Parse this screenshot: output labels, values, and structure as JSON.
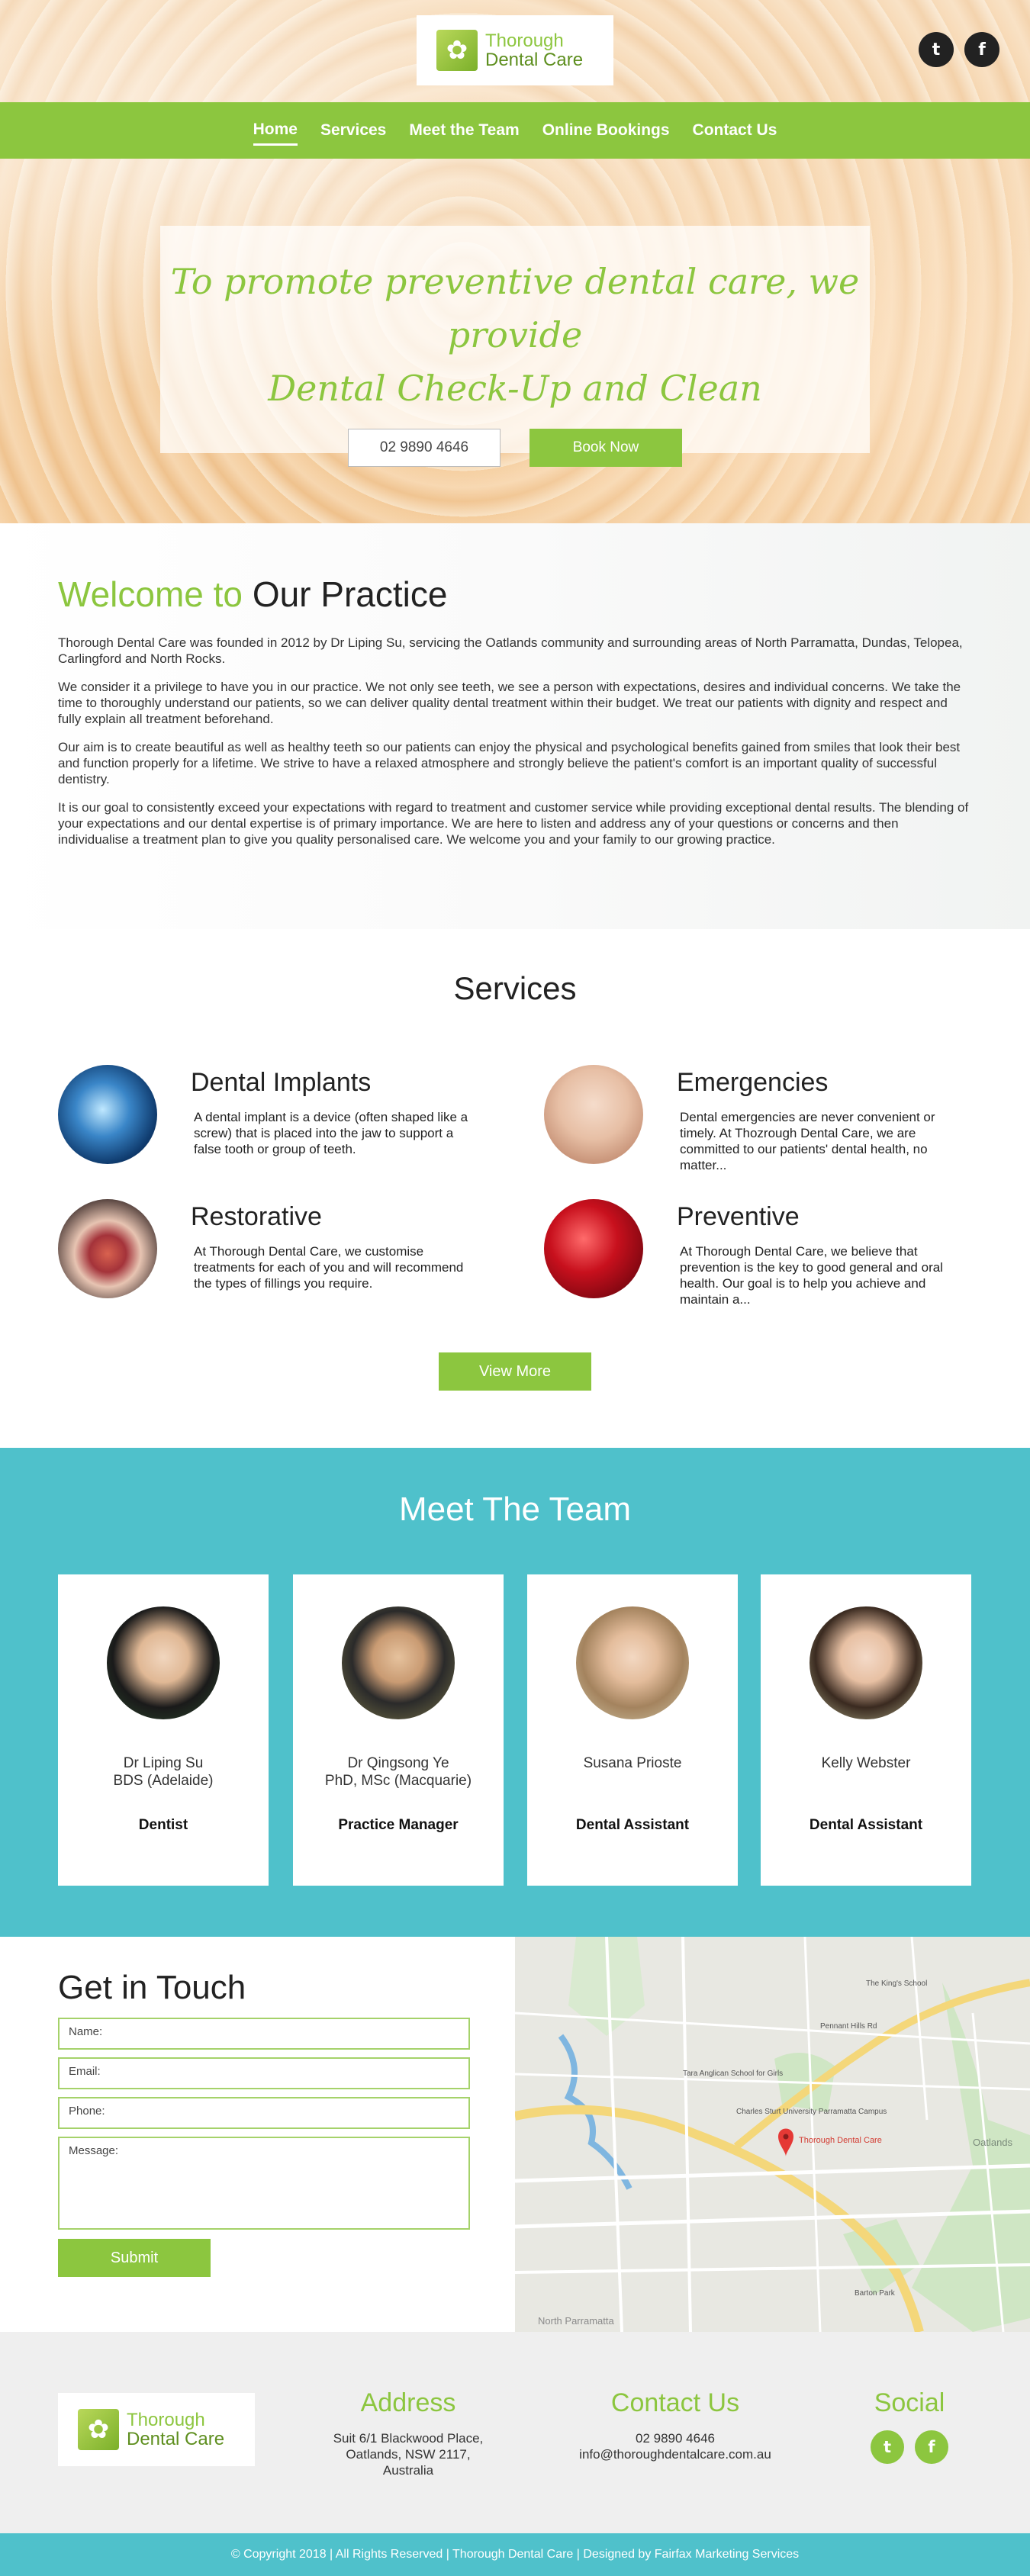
{
  "brand": {
    "name_line1": "Thorough",
    "name_line2": "Dental Care"
  },
  "nav": [
    {
      "label": "Home"
    },
    {
      "label": "Services"
    },
    {
      "label": "Meet the Team"
    },
    {
      "label": "Online Bookings"
    },
    {
      "label": "Contact Us"
    }
  ],
  "hero": {
    "line1": "To promote preventive dental care, we provide",
    "line2": "Dental Check-Up and Clean",
    "phone": "02 9890 4646",
    "book": "Book Now"
  },
  "welcome": {
    "title_green": "Welcome to",
    "title_dark": "Our Practice",
    "paragraphs": [
      "Thorough Dental Care was founded in 2012 by Dr Liping Su, servicing the Oatlands community and surrounding areas of North Parramatta, Dundas, Telopea, Carlingford and North Rocks.",
      "We consider it a privilege to have you in our practice. We not only see teeth, we see a person with expectations, desires and individual concerns. We take the time to thoroughly understand our patients, so we can deliver quality dental treatment within their budget. We treat our patients with dignity and respect and fully explain all treatment beforehand.",
      "Our aim is to create beautiful as well as healthy teeth so our patients can enjoy the physical and psychological benefits gained from smiles that look their best and function properly for a lifetime. We strive to have a relaxed atmosphere and strongly believe the patient's comfort is an important quality of successful dentistry.",
      "It is our goal to consistently exceed your expectations with regard to treatment and customer service while providing exceptional dental results. The blending of your expectations and our dental expertise is of primary importance. We are here to listen and address any of your questions or concerns and then individualise a treatment plan to give you quality personalised care. We welcome you and your family to our growing practice."
    ]
  },
  "services": {
    "title": "Services",
    "items": [
      {
        "title": "Dental Implants",
        "desc": "A dental implant is a device (often shaped like a screw) that is placed into the jaw to support a false tooth or group of teeth."
      },
      {
        "title": "Emergencies",
        "desc": "Dental emergencies are never convenient or timely. At Thozrough Dental Care, we are committed to our patients' dental health, no matter..."
      },
      {
        "title": "Restorative",
        "desc": "At Thorough Dental Care, we customise treatments for each of you and will recommend the types of fillings you require."
      },
      {
        "title": "Preventive",
        "desc": "At Thorough Dental Care, we believe that prevention is the key to good general and oral health. Our goal is to help you achieve and maintain a..."
      }
    ],
    "more": "View More"
  },
  "team": {
    "title": "Meet The Team",
    "members": [
      {
        "name": "Dr Liping Su",
        "cred": "BDS (Adelaide)",
        "role": "Dentist"
      },
      {
        "name": "Dr Qingsong Ye",
        "cred": "PhD, MSc (Macquarie)",
        "role": "Practice Manager"
      },
      {
        "name": "Susana Prioste",
        "cred": "",
        "role": "Dental Assistant"
      },
      {
        "name": "Kelly Webster",
        "cred": "",
        "role": "Dental Assistant"
      }
    ]
  },
  "contact": {
    "title": "Get in Touch",
    "name_ph": "Name:",
    "email_ph": "Email:",
    "phone_ph": "Phone:",
    "message_ph": "Message:",
    "submit": "Submit"
  },
  "map": {
    "pin_label": "Thorough Dental Care",
    "labels": [
      "The King's School",
      "Tara Anglican School for Girls",
      "Charles Sturt University Parramatta Campus",
      "Barton Park",
      "Oatlands",
      "North Parramatta",
      "Pennant Hills Rd"
    ]
  },
  "footer": {
    "address_h": "Address",
    "address_lines": [
      "Suit 6/1 Blackwood Place,",
      "Oatlands, NSW 2117,",
      "Australia"
    ],
    "contact_h": "Contact Us",
    "phone": "02 9890 4646",
    "email": "info@thoroughdentalcare.com.au",
    "social_h": "Social",
    "copyright": "© Copyright 2018 | All Rights Reserved | Thorough Dental Care | Designed by Fairfax Marketing Services"
  },
  "colors": {
    "green": "#8cc63f",
    "teal": "#4fc1cb"
  },
  "icons": {
    "twitter": "twitter-icon",
    "facebook": "facebook-icon",
    "pin": "map-pin-icon"
  }
}
